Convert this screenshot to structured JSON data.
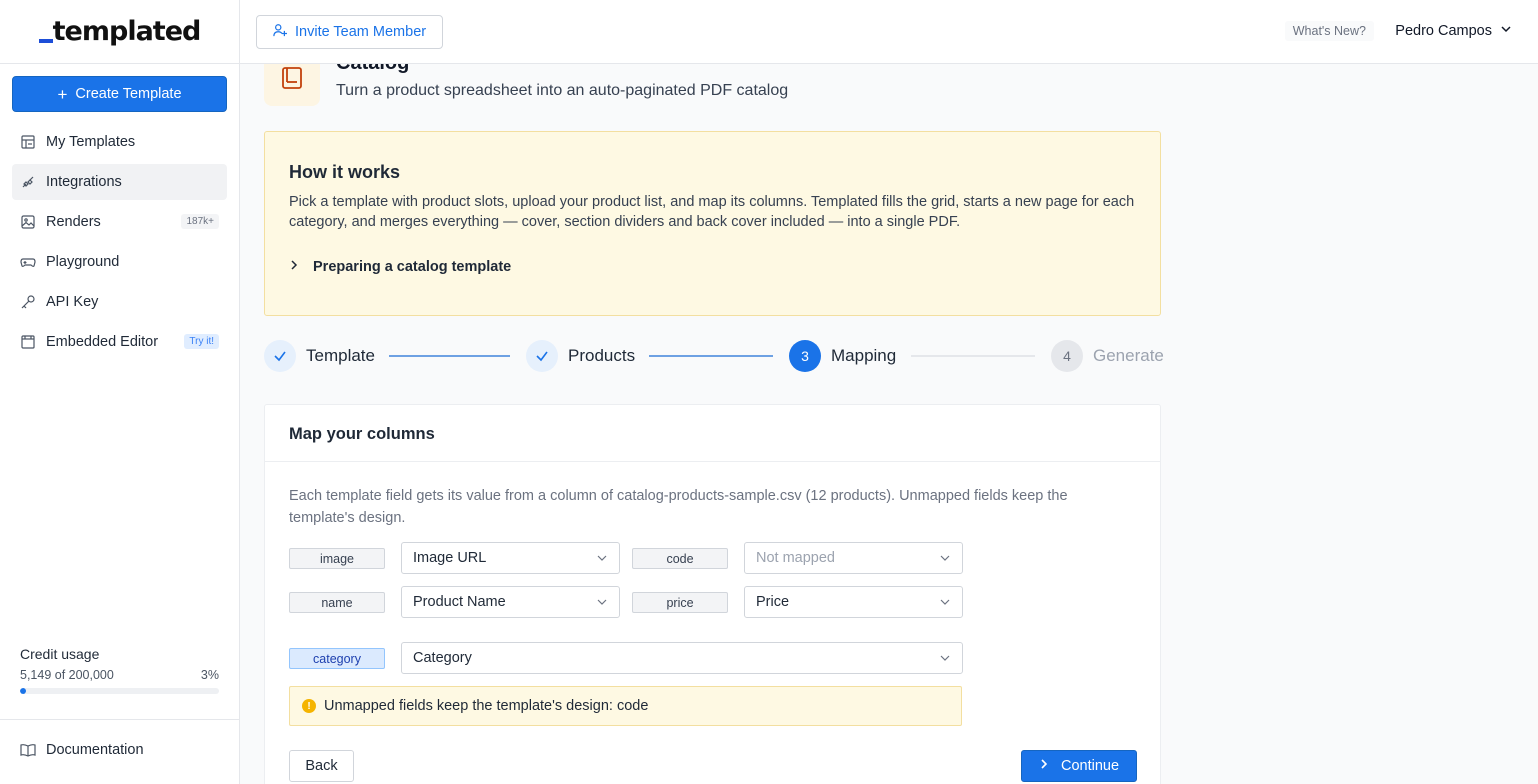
{
  "brand": {
    "logo_text": "templated"
  },
  "sidebar": {
    "create_label": "Create Template",
    "items": [
      {
        "label": "My Templates",
        "icon": "templates-icon"
      },
      {
        "label": "Integrations",
        "icon": "integrations-icon",
        "active": true
      },
      {
        "label": "Renders",
        "icon": "image-icon",
        "badge": "187k+"
      },
      {
        "label": "Playground",
        "icon": "gamepad-icon"
      },
      {
        "label": "API Key",
        "icon": "key-icon"
      },
      {
        "label": "Embedded Editor",
        "icon": "window-icon",
        "badge": "Try it!"
      }
    ],
    "credit": {
      "title": "Credit usage",
      "used_text": "5,149 of 200,000",
      "percent_text": "3%",
      "percent": 3
    },
    "documentation_label": "Documentation"
  },
  "header": {
    "invite_label": "Invite Team Member",
    "whats_new_label": "What's New?",
    "user_name": "Pedro Campos"
  },
  "page": {
    "title": "Catalog",
    "subtitle": "Turn a product spreadsheet into an auto-paginated PDF catalog"
  },
  "how_it_works": {
    "title": "How it works",
    "text": "Pick a template with product slots, upload your product list, and map its columns. Templated fills the grid, starts a new page for each category, and merges everything — cover, section dividers and back cover included — into a single PDF.",
    "expand_label": "Preparing a catalog template"
  },
  "stepper": {
    "steps": [
      {
        "label": "Template",
        "number": "1",
        "state": "done"
      },
      {
        "label": "Products",
        "number": "2",
        "state": "done"
      },
      {
        "label": "Mapping",
        "number": "3",
        "state": "current"
      },
      {
        "label": "Generate",
        "number": "4",
        "state": "todo"
      }
    ]
  },
  "mapping": {
    "title": "Map your columns",
    "description": "Each template field gets its value from a column of catalog-products-sample.csv (12 products). Unmapped fields keep the template's design.",
    "fields": [
      {
        "field": "image",
        "value": "Image URL"
      },
      {
        "field": "code",
        "value": "Not mapped"
      },
      {
        "field": "name",
        "value": "Product Name"
      },
      {
        "field": "price",
        "value": "Price"
      },
      {
        "field": "category",
        "value": "Category"
      }
    ],
    "warning": "Unmapped fields keep the template's design: code",
    "back_label": "Back",
    "continue_label": "Continue"
  },
  "colors": {
    "accent": "#1a73e8",
    "notice_bg": "#fef9e3",
    "notice_border": "#f3dfa0"
  }
}
